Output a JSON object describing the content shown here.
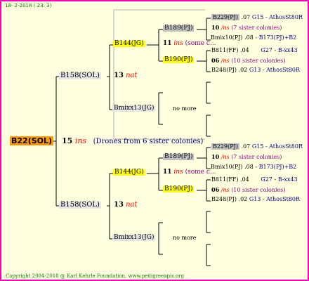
{
  "header": {
    "date_text": "18-  2-2018 ( 23:  3)"
  },
  "footer": {
    "copyright": "Copyright 2004-2018 @ Karl Kehrle Foundation.   www.pedigreeapis.org"
  },
  "root": {
    "id": "B22(SOL)",
    "drone_num": "15",
    "drone_mark": "ins",
    "drone_note": "(Drones from 6 sister colonies)"
  },
  "upper": {
    "id": "B158(SOL)",
    "drone_num": "13",
    "drone_mark": "nat",
    "queen_a": {
      "id": "B144(JG)",
      "drone_num": "11",
      "drone_mark": "ins",
      "drone_note": "(some c...",
      "ggq1": "B189(PJ)",
      "ggq2": "B190(PJ)"
    },
    "queen_b": {
      "id": "Bmixx13(JG)",
      "note": "no more"
    },
    "leaves": {
      "l1": {
        "id": "B229(PJ)",
        "year": ".07",
        "extra": "G15 - AthosSt80R"
      },
      "l2": {
        "num": "10",
        "mark": "/ns",
        "note": "(7 sister colonies)"
      },
      "l3": {
        "id": "Bmix10(PJ)",
        "year": ".08",
        "extra": "- B173(PJ)+B2"
      },
      "l4": {
        "id": "B811(FF)",
        "year": ".04",
        "extra": "G27 - B-xx43"
      },
      "l5": {
        "num": "06",
        "mark": "/ns",
        "note": "(10 sister colonies)"
      },
      "l6": {
        "id": "B248(PJ)",
        "year": ".02",
        "extra": "G13 - AthosSt80R"
      }
    }
  },
  "lower": {
    "id": "B158(SOL)",
    "drone_num": "13",
    "drone_mark": "nat",
    "queen_a": {
      "id": "B144(JG)",
      "drone_num": "11",
      "drone_mark": "ins",
      "drone_note": "(some c...",
      "ggq1": "B189(PJ)",
      "ggq2": "B190(PJ)"
    },
    "queen_b": {
      "id": "Bmixx13(JG)",
      "note": "no more"
    },
    "leaves": {
      "l1": {
        "id": "B229(PJ)",
        "year": ".07",
        "extra": "G15 - AthosSt80R"
      },
      "l2": {
        "num": "10",
        "mark": "/ns",
        "note": "(7 sister colonies)"
      },
      "l3": {
        "id": "Bmix10(PJ)",
        "year": ".08",
        "extra": "- B173(PJ)+B2"
      },
      "l4": {
        "id": "B811(FF)",
        "year": ".04",
        "extra": "G27 - B-xx43"
      },
      "l5": {
        "num": "06",
        "mark": "/ns",
        "note": "(10 sister colonies)"
      },
      "l6": {
        "id": "B248(PJ)",
        "year": ".02",
        "extra": "G13 - AthosSt80R"
      }
    }
  }
}
